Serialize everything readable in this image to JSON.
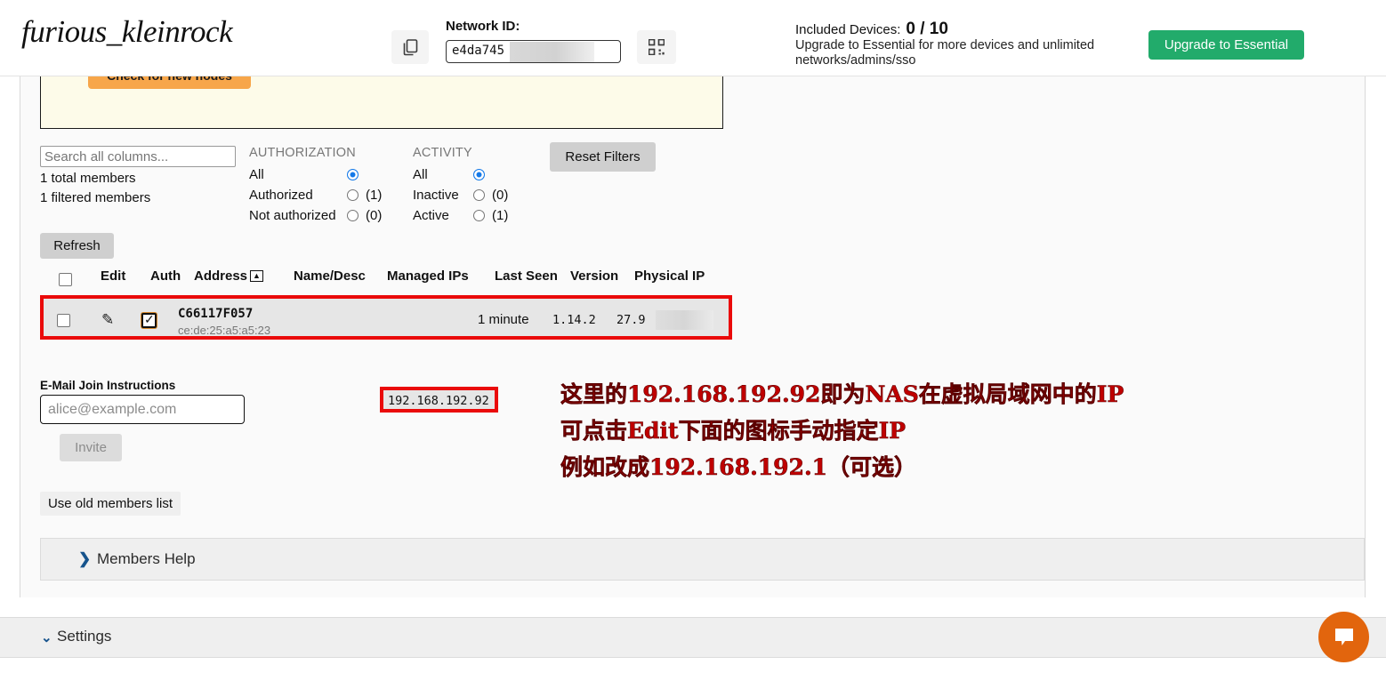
{
  "header": {
    "brand": "furious_kleinrock",
    "network_id_label": "Network ID:",
    "network_id_value": "e4da745",
    "copy_icon": "copy-icon",
    "qr_icon": "qr-code-icon",
    "included_devices_label": "Included Devices:",
    "included_devices_value": "0 / 10",
    "upgrade_text": "Upgrade to Essential for more devices and unlimited networks/admins/sso",
    "upgrade_button": "Upgrade to Essential",
    "upgrade_button_color": "#22ab6b"
  },
  "notice": {
    "button_label": "Check for new nodes",
    "background": "#fdfbe9",
    "button_color": "#f7a64a"
  },
  "filters": {
    "search_placeholder": "Search all columns...",
    "search_value": "",
    "total_members": "1 total members",
    "filtered_members": "1 filtered members",
    "authorization": {
      "title": "AUTHORIZATION",
      "options": [
        {
          "label": "All",
          "count": "",
          "selected": true
        },
        {
          "label": "Authorized",
          "count": "(1)",
          "selected": false
        },
        {
          "label": "Not authorized",
          "count": "(0)",
          "selected": false
        }
      ]
    },
    "activity": {
      "title": "ACTIVITY",
      "options": [
        {
          "label": "All",
          "count": "",
          "selected": true
        },
        {
          "label": "Inactive",
          "count": "(0)",
          "selected": false
        },
        {
          "label": "Active",
          "count": "(1)",
          "selected": false
        }
      ]
    },
    "reset_label": "Reset Filters",
    "refresh_label": "Refresh"
  },
  "table": {
    "columns": [
      "Edit",
      "Auth",
      "Address",
      "Name/Desc",
      "Managed IPs",
      "Last Seen",
      "Version",
      "Physical IP"
    ],
    "sort_column": "Address",
    "sort_indicator": "▲",
    "rows": [
      {
        "selected": false,
        "edit_icon": "edit-pencil-icon",
        "auth_checked": true,
        "address": "C66117F057",
        "address_sub": "ce:de:25:a5:a5:23",
        "name_desc": "",
        "managed_ip": "192.168.192.92",
        "last_seen": "1 minute",
        "version": "1.14.2",
        "physical_ip": "27.9"
      }
    ],
    "highlight_color": "#ea0a0a"
  },
  "invite": {
    "label": "E-Mail Join Instructions",
    "placeholder": "alice@example.com",
    "value": "",
    "button_label": "Invite",
    "old_list_label": "Use old members list"
  },
  "accordions": [
    {
      "label": "Members Help",
      "expanded": false,
      "chevron": "❯"
    },
    {
      "label": "Settings",
      "expanded": true,
      "chevron": "⌄"
    }
  ],
  "annotation": {
    "color": "#c00000",
    "lines": [
      "这里的192.168.192.92即为NAS在虚拟局域网中的IP",
      "可点击Edit下面的图标手动指定IP",
      "例如改成192.168.192.1（可选）"
    ]
  },
  "chat": {
    "icon": "chat-bubble-icon",
    "color": "#e2650d"
  }
}
